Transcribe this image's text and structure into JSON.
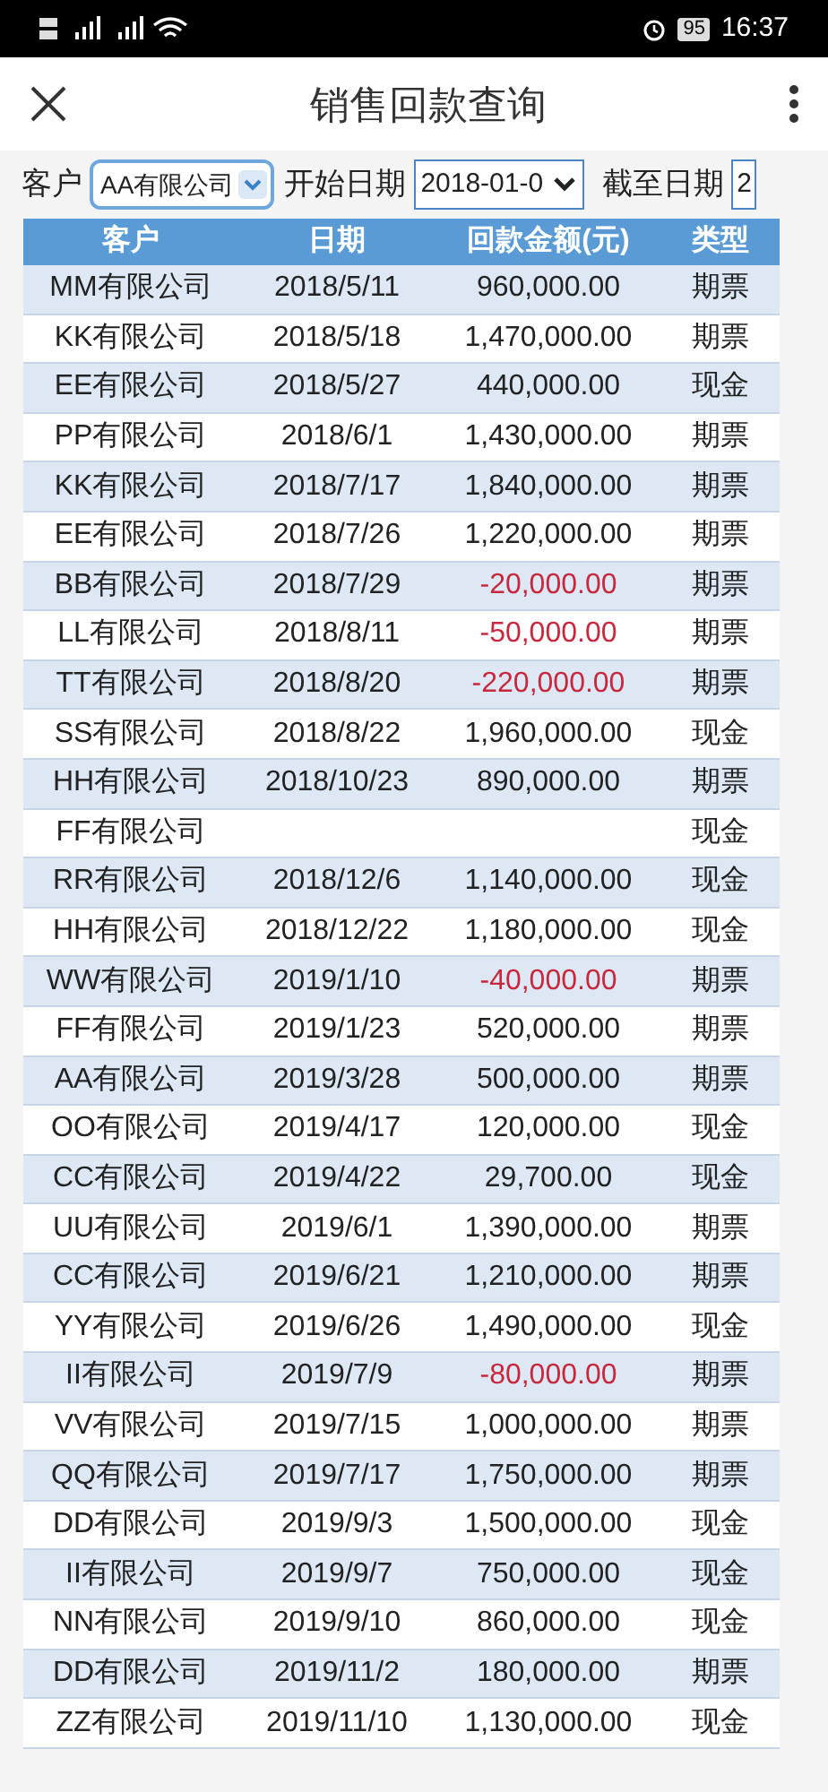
{
  "status_bar": {
    "battery": "95",
    "time": "16:37"
  },
  "header": {
    "title": "销售回款查询"
  },
  "filters": [
    {
      "label": "客户",
      "value": "AA有限公司",
      "kind": "select"
    },
    {
      "label": "开始日期",
      "value": "2018-01-0",
      "kind": "date"
    },
    {
      "label": "截至日期",
      "value": "2",
      "kind": "cut"
    }
  ],
  "table": {
    "columns": [
      "客户",
      "日期",
      "回款金额(元)",
      "类型"
    ],
    "rows": [
      {
        "customer": "MM有限公司",
        "date": "2018/5/11",
        "amount": "960,000.00",
        "negative": false,
        "type": "期票"
      },
      {
        "customer": "KK有限公司",
        "date": "2018/5/18",
        "amount": "1,470,000.00",
        "negative": false,
        "type": "期票"
      },
      {
        "customer": "EE有限公司",
        "date": "2018/5/27",
        "amount": "440,000.00",
        "negative": false,
        "type": "现金"
      },
      {
        "customer": "PP有限公司",
        "date": "2018/6/1",
        "amount": "1,430,000.00",
        "negative": false,
        "type": "期票"
      },
      {
        "customer": "KK有限公司",
        "date": "2018/7/17",
        "amount": "1,840,000.00",
        "negative": false,
        "type": "期票"
      },
      {
        "customer": "EE有限公司",
        "date": "2018/7/26",
        "amount": "1,220,000.00",
        "negative": false,
        "type": "期票"
      },
      {
        "customer": "BB有限公司",
        "date": "2018/7/29",
        "amount": "-20,000.00",
        "negative": true,
        "type": "期票"
      },
      {
        "customer": "LL有限公司",
        "date": "2018/8/11",
        "amount": "-50,000.00",
        "negative": true,
        "type": "期票"
      },
      {
        "customer": "TT有限公司",
        "date": "2018/8/20",
        "amount": "-220,000.00",
        "negative": true,
        "type": "期票"
      },
      {
        "customer": "SS有限公司",
        "date": "2018/8/22",
        "amount": "1,960,000.00",
        "negative": false,
        "type": "现金"
      },
      {
        "customer": "HH有限公司",
        "date": "2018/10/23",
        "amount": "890,000.00",
        "negative": false,
        "type": "期票"
      },
      {
        "customer": "FF有限公司",
        "type": "现金"
      },
      {
        "customer": "RR有限公司",
        "date": "2018/12/6",
        "amount": "1,140,000.00",
        "negative": false,
        "type": "现金"
      },
      {
        "customer": "HH有限公司",
        "date": "2018/12/22",
        "amount": "1,180,000.00",
        "negative": false,
        "type": "现金"
      },
      {
        "customer": "WW有限公司",
        "date": "2019/1/10",
        "amount": "-40,000.00",
        "negative": true,
        "type": "期票"
      },
      {
        "customer": "FF有限公司",
        "date": "2019/1/23",
        "amount": "520,000.00",
        "negative": false,
        "type": "期票"
      },
      {
        "customer": "AA有限公司",
        "date": "2019/3/28",
        "amount": "500,000.00",
        "negative": false,
        "type": "期票"
      },
      {
        "customer": "OO有限公司",
        "date": "2019/4/17",
        "amount": "120,000.00",
        "negative": false,
        "type": "现金"
      },
      {
        "customer": "CC有限公司",
        "date": "2019/4/22",
        "amount": "29,700.00",
        "negative": false,
        "type": "现金"
      },
      {
        "customer": "UU有限公司",
        "date": "2019/6/1",
        "amount": "1,390,000.00",
        "negative": false,
        "type": "期票"
      },
      {
        "customer": "CC有限公司",
        "date": "2019/6/21",
        "amount": "1,210,000.00",
        "negative": false,
        "type": "期票"
      },
      {
        "customer": "YY有限公司",
        "date": "2019/6/26",
        "amount": "1,490,000.00",
        "negative": false,
        "type": "现金"
      },
      {
        "customer": "II有限公司",
        "date": "2019/7/9",
        "amount": "-80,000.00",
        "negative": true,
        "type": "期票"
      },
      {
        "customer": "VV有限公司",
        "date": "2019/7/15",
        "amount": "1,000,000.00",
        "negative": false,
        "type": "期票"
      },
      {
        "customer": "QQ有限公司",
        "date": "2019/7/17",
        "amount": "1,750,000.00",
        "negative": false,
        "type": "期票"
      },
      {
        "customer": "DD有限公司",
        "date": "2019/9/3",
        "amount": "1,500,000.00",
        "negative": false,
        "type": "现金"
      },
      {
        "customer": "II有限公司",
        "date": "2019/9/7",
        "amount": "750,000.00",
        "negative": false,
        "type": "现金"
      },
      {
        "customer": "NN有限公司",
        "date": "2019/9/10",
        "amount": "860,000.00",
        "negative": false,
        "type": "现金"
      },
      {
        "customer": "DD有限公司",
        "date": "2019/11/2",
        "amount": "180,000.00",
        "negative": false,
        "type": "期票"
      },
      {
        "customer": "ZZ有限公司",
        "date": "2019/11/10",
        "amount": "1,130,000.00",
        "negative": false,
        "type": "现金"
      }
    ]
  }
}
